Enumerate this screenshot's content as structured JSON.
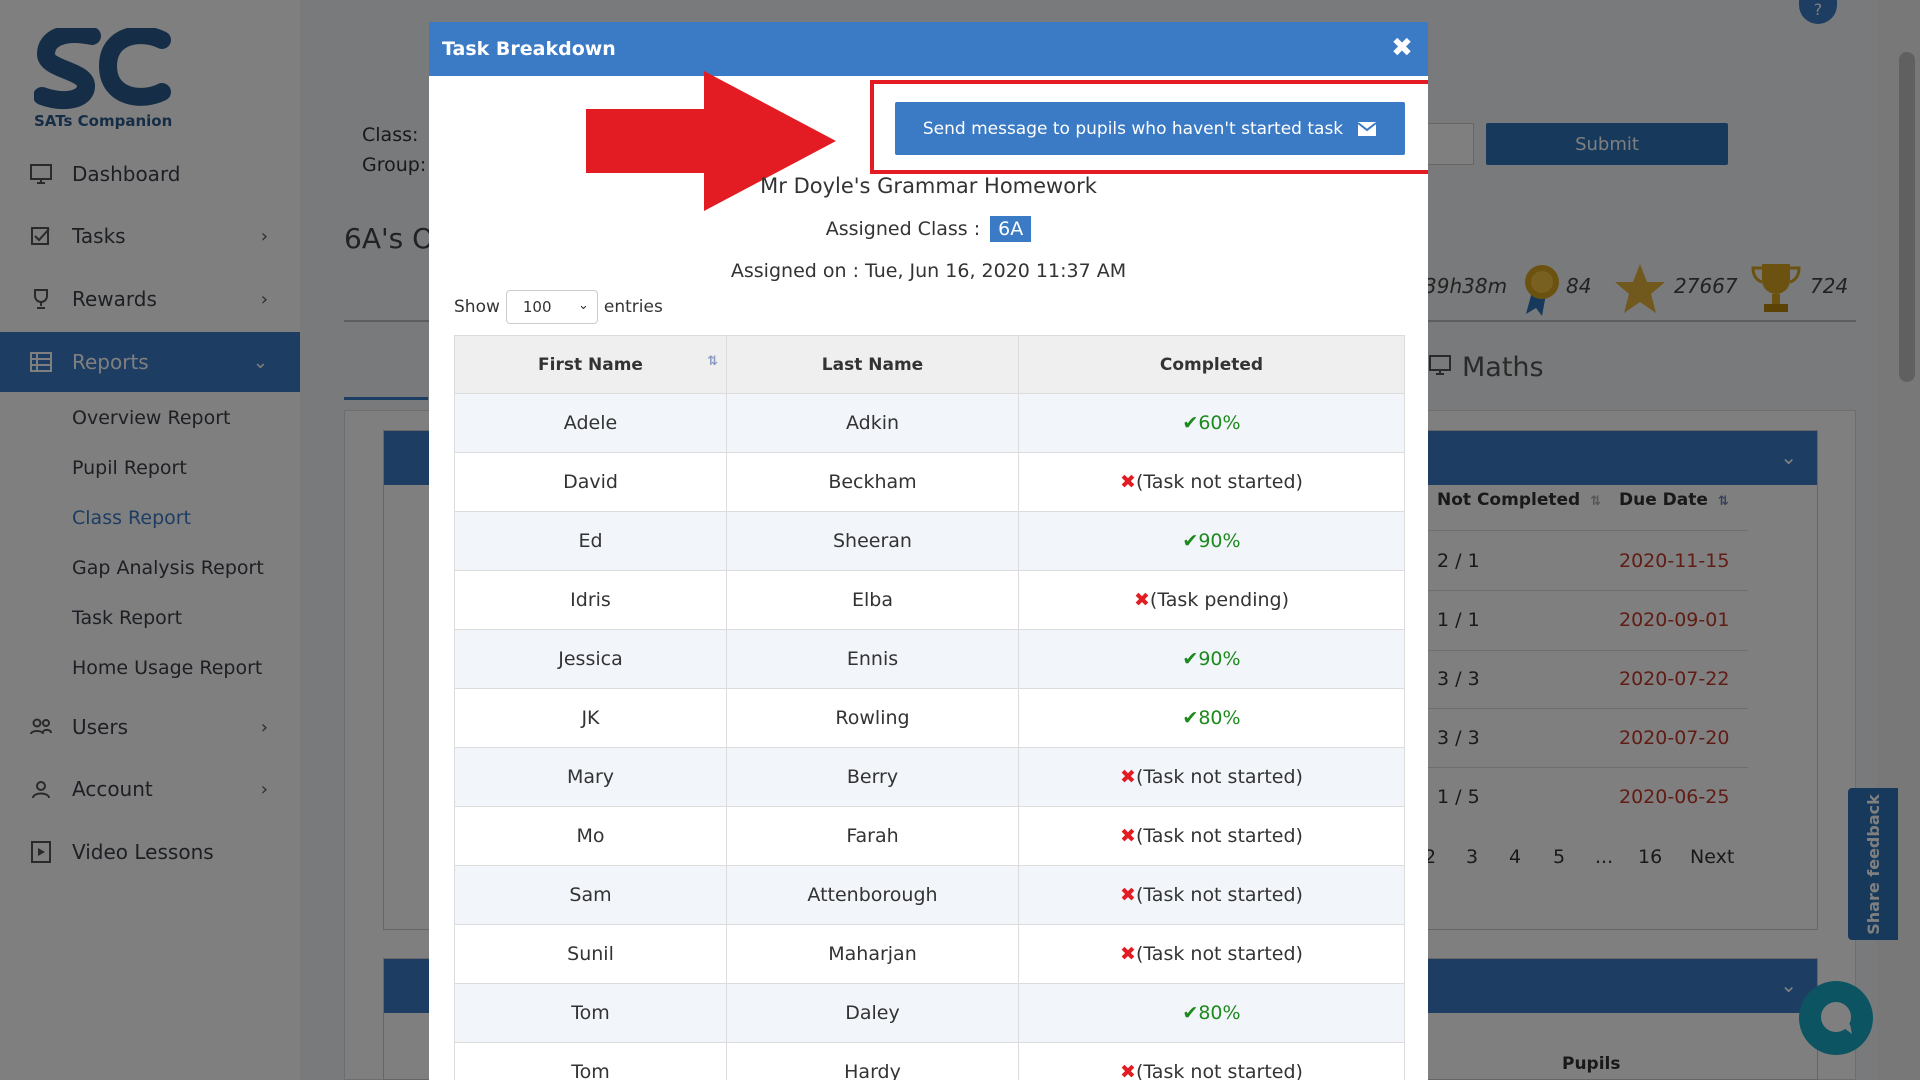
{
  "sidebar": {
    "logo_text": "SATs Companion",
    "items": [
      {
        "label": "Dashboard",
        "icon": "monitor-icon",
        "has_chevron": false
      },
      {
        "label": "Tasks",
        "icon": "tasks-icon",
        "has_chevron": true
      },
      {
        "label": "Rewards",
        "icon": "trophy-icon",
        "has_chevron": true
      },
      {
        "label": "Reports",
        "icon": "reports-icon",
        "has_chevron": true,
        "active": true
      },
      {
        "label": "Users",
        "icon": "users-icon",
        "has_chevron": true
      },
      {
        "label": "Account",
        "icon": "account-icon",
        "has_chevron": true
      },
      {
        "label": "Video Lessons",
        "icon": "video-icon",
        "has_chevron": false
      }
    ],
    "report_subitems": [
      "Overview Report",
      "Pupil Report",
      "Class Report",
      "Gap Analysis Report",
      "Task Report",
      "Home Usage Report"
    ],
    "current_subitem": "Class Report"
  },
  "background": {
    "class_label": "Class:",
    "group_label": "Group:",
    "page_title": "6A's O",
    "submit_label": "Submit",
    "stats": {
      "time": "39h38m",
      "medals": "84",
      "stars": "27667",
      "trophies": "724"
    },
    "tab_label": "Maths",
    "table_headers": {
      "not_completed": "Not Completed",
      "due_date": "Due Date",
      "pupils": "Pupils"
    },
    "rows": [
      {
        "not_completed": "2 / 1",
        "due_date": "2020-11-15"
      },
      {
        "not_completed": "1 / 1",
        "due_date": "2020-09-01"
      },
      {
        "not_completed": "3 / 3",
        "due_date": "2020-07-22"
      },
      {
        "not_completed": "3 / 3",
        "due_date": "2020-07-20"
      },
      {
        "not_completed": "1 / 5",
        "due_date": "2020-06-25"
      }
    ],
    "pager": [
      "2",
      "3",
      "4",
      "5",
      "...",
      "16",
      "Next"
    ],
    "feedback_label": "Share feedback",
    "help_label": "?"
  },
  "modal": {
    "title": "Task Breakdown",
    "send_button_label": "Send message to pupils who haven't started task",
    "homework_title": "Mr Doyle's Grammar Homework",
    "assigned_class_label": "Assigned Class :",
    "assigned_class_value": "6A",
    "assigned_on": "Assigned on : Tue, Jun 16, 2020 11:37 AM",
    "show_label": "Show",
    "entries_value": "100",
    "entries_label": "entries",
    "columns": [
      "First Name",
      "Last Name",
      "Completed"
    ],
    "rows": [
      {
        "first": "Adele",
        "last": "Adkin",
        "status": "60%",
        "done": true
      },
      {
        "first": "David",
        "last": "Beckham",
        "status": "(Task not started)",
        "done": false
      },
      {
        "first": "Ed",
        "last": "Sheeran",
        "status": "90%",
        "done": true
      },
      {
        "first": "Idris",
        "last": "Elba",
        "status": "(Task pending)",
        "done": false
      },
      {
        "first": "Jessica",
        "last": "Ennis",
        "status": "90%",
        "done": true
      },
      {
        "first": "JK",
        "last": "Rowling",
        "status": "80%",
        "done": true
      },
      {
        "first": "Mary",
        "last": "Berry",
        "status": "(Task not started)",
        "done": false
      },
      {
        "first": "Mo",
        "last": "Farah",
        "status": "(Task not started)",
        "done": false
      },
      {
        "first": "Sam",
        "last": "Attenborough",
        "status": "(Task not started)",
        "done": false
      },
      {
        "first": "Sunil",
        "last": "Maharjan",
        "status": "(Task not started)",
        "done": false
      },
      {
        "first": "Tom",
        "last": "Daley",
        "status": "80%",
        "done": true
      },
      {
        "first": "Tom",
        "last": "Hardy",
        "status": "(Task not started)",
        "done": false
      }
    ]
  },
  "colors": {
    "primary": "#3b7ac4",
    "highlight": "#e31b23",
    "ok": "#1d8a1d",
    "overdue": "#c0392b"
  }
}
